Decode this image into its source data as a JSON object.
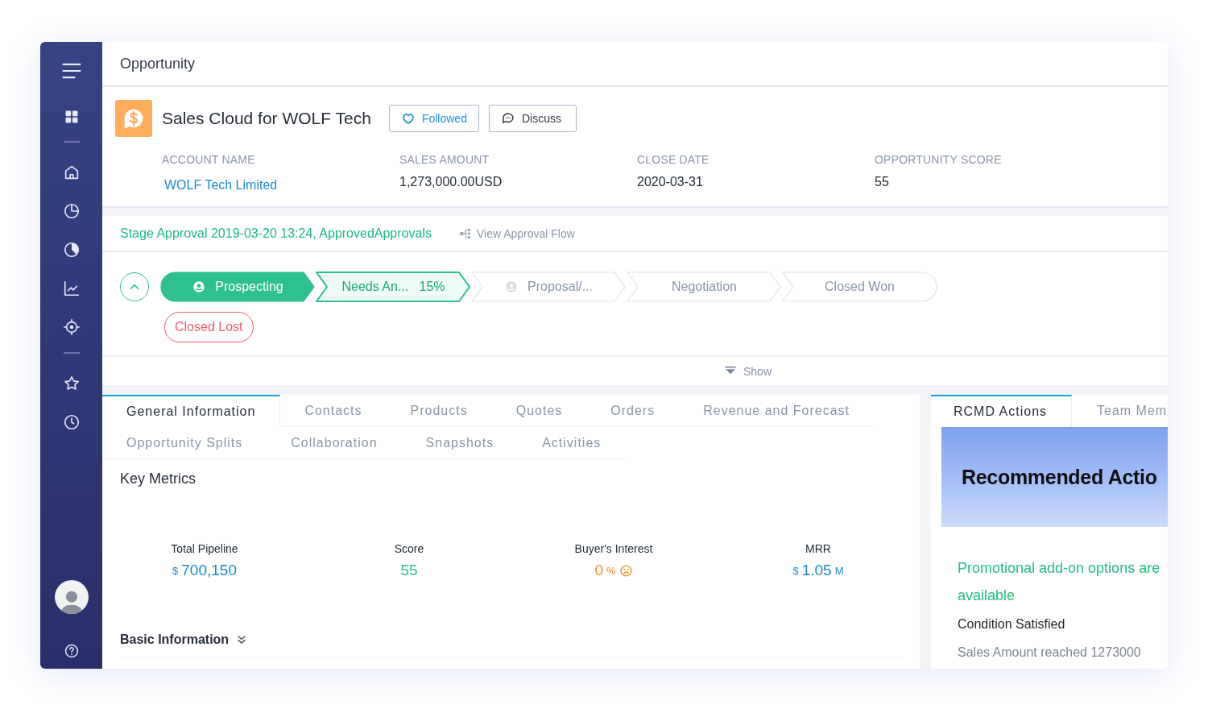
{
  "page_title": "Opportunity",
  "record": {
    "title": "Sales Cloud for WOLF Tech",
    "buttons": [
      {
        "label": "Followed",
        "kind": "follow"
      },
      {
        "label": "Discuss",
        "kind": "discuss"
      }
    ],
    "fields": [
      {
        "label": "ACCOUNT NAME",
        "value": "WOLF Tech Limited",
        "kind": "link"
      },
      {
        "label": "SALES AMOUNT",
        "value": "1,273,000.00USD",
        "kind": "plain"
      },
      {
        "label": "CLOSE DATE",
        "value": "2020-03-31",
        "kind": "plain"
      },
      {
        "label": "OPPORTUNITY SCORE",
        "value": "55",
        "kind": "plain"
      }
    ]
  },
  "approval": {
    "text": "Stage Approval 2019-03-20 13:24, ApprovedApprovals",
    "link": "View Approval Flow"
  },
  "stages": [
    {
      "label": "Prospecting",
      "done": true,
      "current": false,
      "icon": true
    },
    {
      "label": "Needs An...",
      "percent": "15%",
      "done": false,
      "current": true,
      "icon": false
    },
    {
      "label": "Proposal/...",
      "done": false,
      "current": false,
      "icon": true
    },
    {
      "label": "Negotiation",
      "done": false,
      "current": false,
      "icon": false
    },
    {
      "label": "Closed Won",
      "done": false,
      "current": false,
      "icon": false
    }
  ],
  "lost_stage": "Closed Lost",
  "show_toggle": "Show",
  "tab_rows": [
    {
      "tabs": [
        {
          "label": "General Information",
          "selected": true
        },
        {
          "label": "Contacts",
          "selected": false
        },
        {
          "label": "Products",
          "selected": false
        },
        {
          "label": "Quotes",
          "selected": false
        },
        {
          "label": "Orders",
          "selected": false
        },
        {
          "label": "Revenue and Forecast",
          "selected": false
        }
      ]
    },
    {
      "tabs": [
        {
          "label": "Opportunity Splits",
          "selected": false
        },
        {
          "label": "Collaboration",
          "selected": false
        },
        {
          "label": "Snapshots",
          "selected": false
        },
        {
          "label": "Activities",
          "selected": false
        }
      ]
    }
  ],
  "key_metrics": {
    "title": "Key Metrics",
    "items": [
      {
        "label": "Total Pipeline",
        "prefix": "$",
        "value": "700,150",
        "color": "#1a8ad4",
        "kind": "money"
      },
      {
        "label": "Score",
        "value": "55",
        "color": "#2ec08f",
        "kind": "plain"
      },
      {
        "label": "Buyer's Interest",
        "value": "0",
        "suffix": "%",
        "color": "#f5892a",
        "kind": "interest"
      },
      {
        "label": "MRR",
        "prefix": "$",
        "value": "1.05",
        "suffix": "M",
        "color": "#1a8ad4",
        "kind": "money"
      }
    ]
  },
  "basic_information": "Basic Information",
  "side_tabs": [
    {
      "label": "RCMD Actions",
      "selected": true
    },
    {
      "label": "Team Mem",
      "selected": false
    }
  ],
  "banner": "Recommended Actio",
  "recommendation": {
    "title": "Promotional add-on options are available",
    "condition_label": "Condition Satisfied",
    "condition": "Sales Amount reached 1273000"
  }
}
